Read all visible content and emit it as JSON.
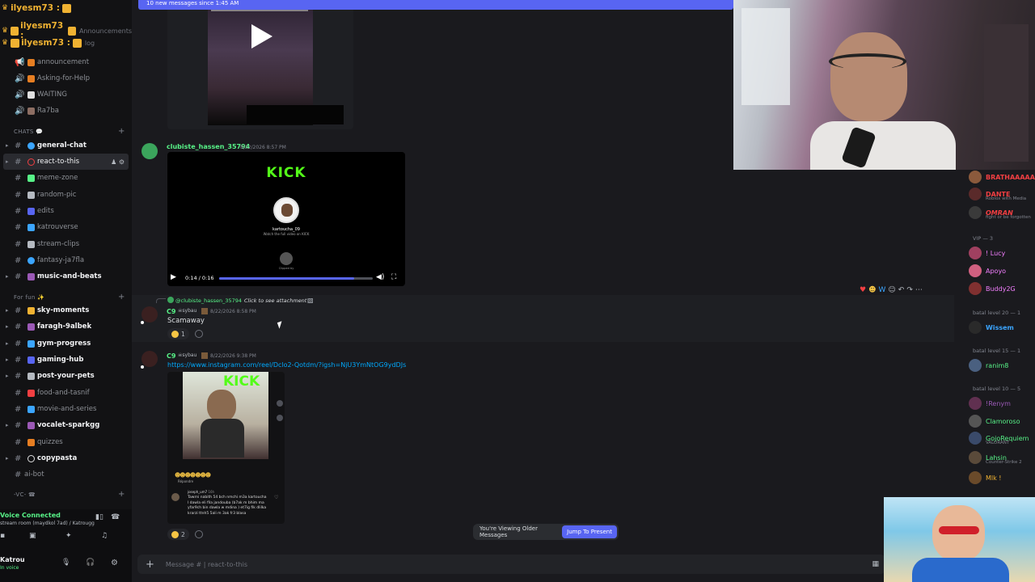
{
  "banner": {
    "text": "10 new messages since 1:45 AM"
  },
  "voice_users": [
    {
      "name": "ilyesm73 :",
      "extra": ""
    },
    {
      "name": "ilyesm73 :",
      "extra": "Announcements"
    },
    {
      "name": "ilyesm73 :",
      "extra": "log"
    }
  ],
  "sidebar": {
    "voice_channels": [
      {
        "label": "announcement",
        "color": "#e67e22"
      },
      {
        "label": "Asking-for-Help",
        "color": "#e67e22"
      },
      {
        "label": "WAITING",
        "color": "#e0e0e0"
      },
      {
        "label": "Ra7ba",
        "color": "#8d6e63"
      }
    ],
    "chats_category": "CHATS 💬",
    "chats": [
      {
        "label": "general-chat",
        "color": "#3ba5ff",
        "bold": true
      },
      {
        "label": "react-to-this",
        "color": "#f23f42",
        "active": true
      },
      {
        "label": "meme-zone",
        "color": "#57f287"
      },
      {
        "label": "random-pic",
        "color": "#b5bac1"
      },
      {
        "label": "edits",
        "color": "#5865f2"
      },
      {
        "label": "katrouverse",
        "color": "#3ba5ff"
      },
      {
        "label": "stream-clips",
        "color": "#b5bac1"
      },
      {
        "label": "fantasy-ja7fla",
        "color": "#3ba5ff"
      },
      {
        "label": "music-and-beats",
        "color": "#9b59b6",
        "bold": true
      }
    ],
    "fun_category": "For fun ✨",
    "fun": [
      {
        "label": "sky-moments",
        "color": "#f0b232",
        "bold": true
      },
      {
        "label": "faragh-9albek",
        "color": "#9b59b6",
        "bold": true
      },
      {
        "label": "gym-progress",
        "color": "#3ba5ff",
        "bold": true
      },
      {
        "label": "gaming-hub",
        "color": "#5865f2",
        "bold": true
      },
      {
        "label": "post-your-pets",
        "color": "#b5bac1",
        "bold": true
      },
      {
        "label": "food-and-tasnif",
        "color": "#f23f42"
      },
      {
        "label": "movie-and-series",
        "color": "#3ba5ff"
      },
      {
        "label": "vocalet-sparkgg",
        "color": "#9b59b6",
        "bold": true
      },
      {
        "label": "quizzes",
        "color": "#e67e22"
      },
      {
        "label": "copypasta",
        "color": "#e0e0e0",
        "bold": true
      },
      {
        "label": "ai-bot",
        "color": "#b5bac1"
      }
    ],
    "vc_category": "-VC- ☎"
  },
  "voice_panel": {
    "status": "Voice Connected",
    "room": "stream room (maydkol 7ad) / Katrougg",
    "user_name": "Katrou",
    "user_status": "In voice"
  },
  "messages": {
    "msg1": {
      "author": "clubiste_hassen_35794",
      "time": "8/22/2026 8:57 PM"
    },
    "video": {
      "brand": "KICK",
      "channel": "kartoucha_09",
      "caption": "Watch the full video on KICK",
      "clipped": "Clipped by",
      "time": "0:14 / 0:16",
      "progress": 0.88
    },
    "reply_to": {
      "author": "@clubiste_hassen_35794",
      "text": "Click to see attachment"
    },
    "msg2": {
      "author": "C9",
      "badge": "sybau",
      "time": "8/22/2026 8:58 PM",
      "text": "Scamaway",
      "reaction_count": "1"
    },
    "msg3": {
      "author": "C9",
      "badge": "sybau",
      "time": "8/22/2026 9:38 PM",
      "link": "https://www.instagram.com/reel/Dclo2-Qotdm/?igsh=NjU3YmNtOG9ydDJs",
      "reaction_count": "2"
    },
    "embed": {
      "kick": "KICK",
      "reply_label": "Répondre",
      "commenter": "joseph_um7",
      "age": "16h",
      "comment_text": "Tawrni nabith 54 bch nmchi m3a kartoucha l dawla eli fila jandouba (b7ak m bhim ma yfar9ch bin dawla w mdina ) et7ig fik dlilka krarzi ttnh5 5ali m 3ak fr3 blasa"
    }
  },
  "jump_pill": {
    "text": "You're Viewing Older Messages",
    "button": "Jump To Present"
  },
  "composer": {
    "placeholder": "Message # | react-to-this"
  },
  "members": [
    {
      "name": "BRATHAAAAAA",
      "color": "#f23f42",
      "av": "#8b5a3c"
    },
    {
      "name": "DANTE",
      "color": "#f23f42",
      "sub": "Roblox with Media",
      "av": "#5a2a2a"
    },
    {
      "name": "OMRAN",
      "color": "#f23f42",
      "sub": "fight or be forgotten",
      "av": "#3a3a3a"
    }
  ],
  "vip_header": "VIP — 3",
  "vips": [
    {
      "name": "! Lucy",
      "color": "#f47fff",
      "av": "#a04060"
    },
    {
      "name": "Apoyo",
      "color": "#f47fff",
      "av": "#d06080"
    },
    {
      "name": "Buddy2G",
      "color": "#f47fff",
      "av": "#803030"
    }
  ],
  "lvl20_header": "batal level 20 — 1",
  "lvl20": [
    {
      "name": "Wissem",
      "color": "#3ba5ff",
      "av": "#2a2a2a"
    }
  ],
  "lvl15_header": "batal level 15 — 1",
  "lvl15": [
    {
      "name": "ranim8",
      "color": "#57f287",
      "av": "#4a6080"
    }
  ],
  "lvl10_header": "batal level 10 — 5",
  "lvl10": [
    {
      "name": "!Renym",
      "color": "#9b59b6",
      "av": "#603050"
    },
    {
      "name": "Clamoroso",
      "color": "#57f287",
      "av": "#555"
    },
    {
      "name": "GojoRequiem",
      "color": "#57f287",
      "sub": "VALORANT",
      "av": "#3a4a6a"
    },
    {
      "name": "Lahsin",
      "color": "#57f287",
      "sub": "Counter-Strike 2",
      "av": "#5a4a3a"
    },
    {
      "name": "Mlk !",
      "color": "#f0b232",
      "av": "#6a4a2a"
    }
  ]
}
